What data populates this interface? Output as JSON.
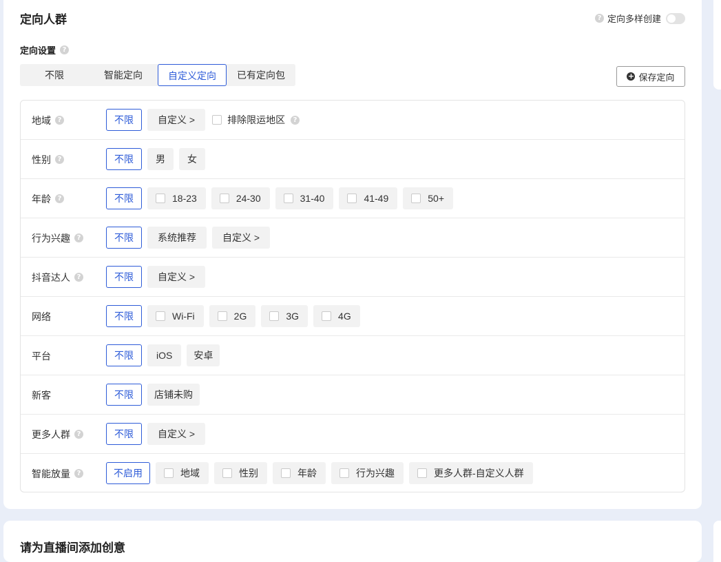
{
  "section": {
    "title": "定向人群",
    "multi_create_label": "定向多样创建",
    "settings_label": "定向设置"
  },
  "segments": [
    "不限",
    "智能定向",
    "自定义定向",
    "已有定向包"
  ],
  "active_segment": "自定义定向",
  "save_button": "保存定向",
  "rows": {
    "region": {
      "label": "地域",
      "options": [
        "不限",
        "自定义 >"
      ],
      "exclude_label": "排除限运地区"
    },
    "gender": {
      "label": "性别",
      "options": [
        "不限",
        "男",
        "女"
      ]
    },
    "age": {
      "label": "年龄",
      "options": [
        "不限",
        "18-23",
        "24-30",
        "31-40",
        "41-49",
        "50+"
      ]
    },
    "interest": {
      "label": "行为兴趣",
      "options": [
        "不限",
        "系统推荐",
        "自定义 >"
      ]
    },
    "douyin": {
      "label": "抖音达人",
      "options": [
        "不限",
        "自定义 >"
      ]
    },
    "network": {
      "label": "网络",
      "options": [
        "不限",
        "Wi-Fi",
        "2G",
        "3G",
        "4G"
      ]
    },
    "platform": {
      "label": "平台",
      "options": [
        "不限",
        "iOS",
        "安卓"
      ]
    },
    "new_customer": {
      "label": "新客",
      "options": [
        "不限",
        "店铺未购"
      ]
    },
    "more_crowd": {
      "label": "更多人群",
      "options": [
        "不限",
        "自定义 >"
      ]
    },
    "smart_expand": {
      "label": "智能放量",
      "options": [
        "不启用",
        "地域",
        "性别",
        "年龄",
        "行为兴趣",
        "更多人群-自定义人群"
      ]
    }
  },
  "next_section": {
    "title": "请为直播间添加创意"
  },
  "colors": {
    "accent": "#2d5bd8",
    "page_bg": "#e9eef8"
  }
}
